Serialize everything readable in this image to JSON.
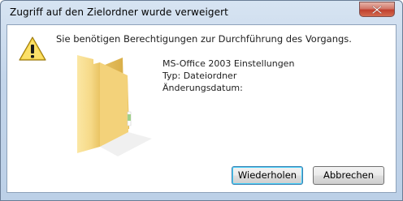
{
  "window": {
    "title": "Zugriff auf den Zielordner wurde verweigert"
  },
  "icons": {
    "warning": "warning-icon",
    "folder": "folder-icon",
    "close": "close-icon"
  },
  "dialog": {
    "message": "Sie benötigen Berechtigungen zur Durchführung des Vorgangs.",
    "item_name": "MS-Office 2003 Einstellungen",
    "item_type": "Typ: Dateiordner",
    "modified_label": "Änderungsdatum:",
    "modified_value": ""
  },
  "buttons": {
    "retry_label": "Wiederholen",
    "cancel_label": "Abbrechen"
  },
  "colors": {
    "title_bar": "#c3d5ea",
    "close_button": "#c0402e",
    "default_button_border": "#3c7fb1"
  }
}
